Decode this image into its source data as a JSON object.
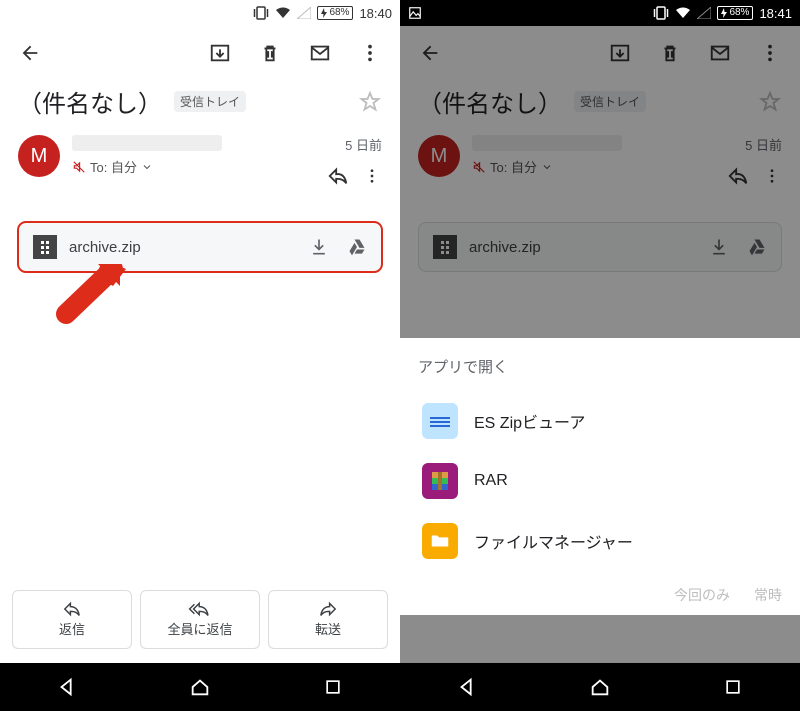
{
  "left": {
    "status": {
      "battery": "68%",
      "time": "18:40"
    },
    "subject": "（件名なし）",
    "inbox_chip": "受信トレイ",
    "avatar_letter": "M",
    "to_label": "To: 自分",
    "date": "5 日前",
    "attachment": {
      "name": "archive.zip"
    },
    "actions": {
      "reply": "返信",
      "reply_all": "全員に返信",
      "forward": "転送"
    }
  },
  "right": {
    "status": {
      "battery": "68%",
      "time": "18:41"
    },
    "subject": "（件名なし）",
    "inbox_chip": "受信トレイ",
    "avatar_letter": "M",
    "to_label": "To: 自分",
    "date": "5 日前",
    "attachment": {
      "name": "archive.zip"
    },
    "sheet": {
      "title": "アプリで開く",
      "apps": [
        {
          "name": "ES Zipビューア"
        },
        {
          "name": "RAR"
        },
        {
          "name": "ファイルマネージャー"
        }
      ],
      "once": "今回のみ",
      "always": "常時"
    }
  }
}
